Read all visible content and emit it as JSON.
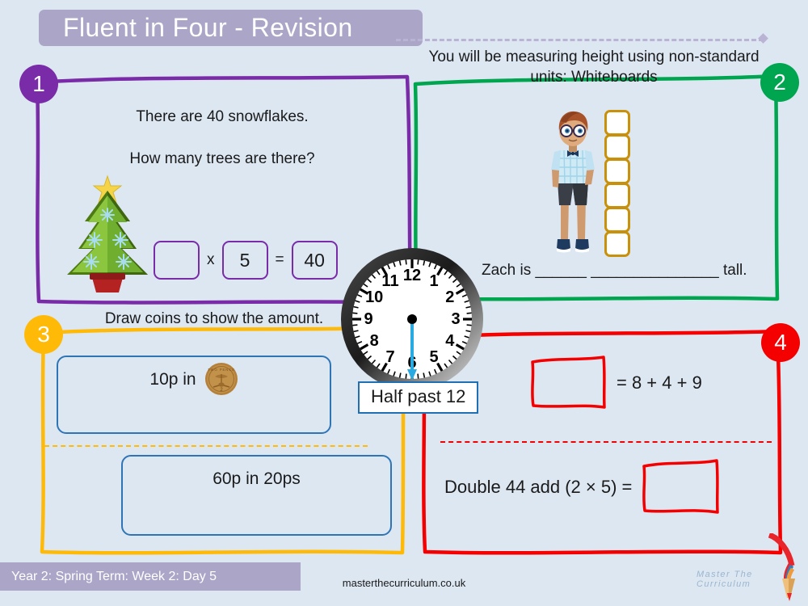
{
  "header": {
    "title": "Fluent in Four - Revision"
  },
  "q1": {
    "badge": "1",
    "accent": "#7a2ba8",
    "line1": "There are 40 snowflakes.",
    "line2": "How many trees are there?",
    "image": "christmas-tree",
    "equation": {
      "box1": "",
      "op1": "x",
      "box2": "5",
      "op2": "=",
      "box3": "40"
    }
  },
  "q2": {
    "badge": "2",
    "accent": "#00a550",
    "heading": "You will be measuring height using non-standard units: Whiteboards",
    "image": "boy-character",
    "whiteboard_count": 6,
    "whiteboard_border": "#c9900a",
    "sentence": "Zach is ______  _______________ tall."
  },
  "q3": {
    "badge": "3",
    "accent": "#ffba08",
    "heading": "Draw coins to show the amount.",
    "box1_label": "10p in",
    "box1_coin": "two-pence-coin",
    "box2_label": "60p in 20ps"
  },
  "q4": {
    "badge": "4",
    "accent": "#f40000",
    "row1_box": "",
    "row1_text": "= 8 + 4 + 9",
    "row2_text": "Double 44 add (2 × 5) =",
    "row2_box": ""
  },
  "clock": {
    "numbers": [
      "12",
      "1",
      "2",
      "3",
      "4",
      "5",
      "6",
      "7",
      "8",
      "9",
      "10",
      "11"
    ],
    "minute_hand_points_to": "6",
    "label": "Half past 12",
    "label_border": "#1f6fb2",
    "hand_color": "#29abe2"
  },
  "footer": {
    "term_label": "Year 2: Spring Term: Week 2: Day 5",
    "url": "masterthecurriculum.co.uk",
    "logo_text": "Master The Curriculum",
    "logo_icon": "pencil-logo"
  }
}
